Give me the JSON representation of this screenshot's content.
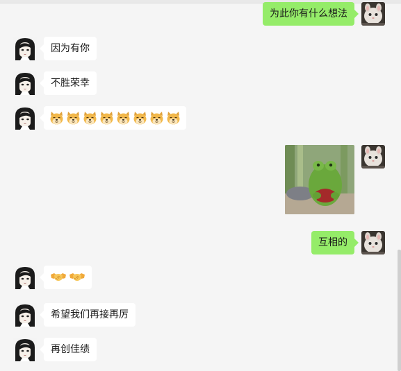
{
  "messages": [
    {
      "side": "right",
      "text": "为此你有什么想法"
    },
    {
      "side": "left",
      "text": "因为有你"
    },
    {
      "side": "left",
      "text": "不胜荣幸"
    },
    {
      "side": "left",
      "emoji": "doge-face-icon",
      "emoji_count": 8
    },
    {
      "side": "right",
      "image": "frog-plush-sticker"
    },
    {
      "side": "right",
      "text": "互相的"
    },
    {
      "side": "left",
      "emoji": "handshake-icon",
      "emoji_count": 2
    },
    {
      "side": "left",
      "text": "希望我们再接再厉"
    },
    {
      "side": "left",
      "text": "再创佳绩"
    }
  ],
  "colors": {
    "background": "#f5f5f5",
    "incoming_bubble": "#ffffff",
    "outgoing_bubble": "#95ec69"
  }
}
